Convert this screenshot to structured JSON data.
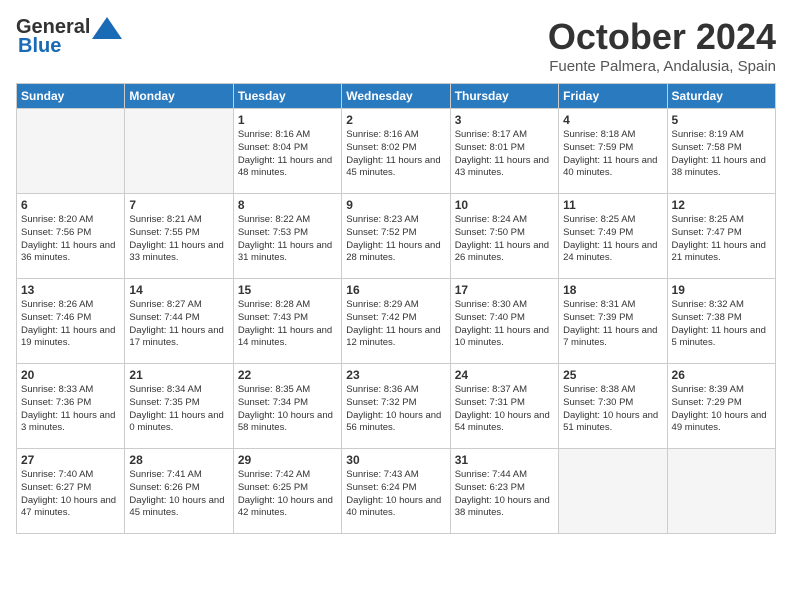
{
  "logo": {
    "line1": "General",
    "line2": "Blue"
  },
  "title": "October 2024",
  "subtitle": "Fuente Palmera, Andalusia, Spain",
  "days_of_week": [
    "Sunday",
    "Monday",
    "Tuesday",
    "Wednesday",
    "Thursday",
    "Friday",
    "Saturday"
  ],
  "weeks": [
    [
      {
        "day": "",
        "info": ""
      },
      {
        "day": "",
        "info": ""
      },
      {
        "day": "1",
        "info": "Sunrise: 8:16 AM\nSunset: 8:04 PM\nDaylight: 11 hours and 48 minutes."
      },
      {
        "day": "2",
        "info": "Sunrise: 8:16 AM\nSunset: 8:02 PM\nDaylight: 11 hours and 45 minutes."
      },
      {
        "day": "3",
        "info": "Sunrise: 8:17 AM\nSunset: 8:01 PM\nDaylight: 11 hours and 43 minutes."
      },
      {
        "day": "4",
        "info": "Sunrise: 8:18 AM\nSunset: 7:59 PM\nDaylight: 11 hours and 40 minutes."
      },
      {
        "day": "5",
        "info": "Sunrise: 8:19 AM\nSunset: 7:58 PM\nDaylight: 11 hours and 38 minutes."
      }
    ],
    [
      {
        "day": "6",
        "info": "Sunrise: 8:20 AM\nSunset: 7:56 PM\nDaylight: 11 hours and 36 minutes."
      },
      {
        "day": "7",
        "info": "Sunrise: 8:21 AM\nSunset: 7:55 PM\nDaylight: 11 hours and 33 minutes."
      },
      {
        "day": "8",
        "info": "Sunrise: 8:22 AM\nSunset: 7:53 PM\nDaylight: 11 hours and 31 minutes."
      },
      {
        "day": "9",
        "info": "Sunrise: 8:23 AM\nSunset: 7:52 PM\nDaylight: 11 hours and 28 minutes."
      },
      {
        "day": "10",
        "info": "Sunrise: 8:24 AM\nSunset: 7:50 PM\nDaylight: 11 hours and 26 minutes."
      },
      {
        "day": "11",
        "info": "Sunrise: 8:25 AM\nSunset: 7:49 PM\nDaylight: 11 hours and 24 minutes."
      },
      {
        "day": "12",
        "info": "Sunrise: 8:25 AM\nSunset: 7:47 PM\nDaylight: 11 hours and 21 minutes."
      }
    ],
    [
      {
        "day": "13",
        "info": "Sunrise: 8:26 AM\nSunset: 7:46 PM\nDaylight: 11 hours and 19 minutes."
      },
      {
        "day": "14",
        "info": "Sunrise: 8:27 AM\nSunset: 7:44 PM\nDaylight: 11 hours and 17 minutes."
      },
      {
        "day": "15",
        "info": "Sunrise: 8:28 AM\nSunset: 7:43 PM\nDaylight: 11 hours and 14 minutes."
      },
      {
        "day": "16",
        "info": "Sunrise: 8:29 AM\nSunset: 7:42 PM\nDaylight: 11 hours and 12 minutes."
      },
      {
        "day": "17",
        "info": "Sunrise: 8:30 AM\nSunset: 7:40 PM\nDaylight: 11 hours and 10 minutes."
      },
      {
        "day": "18",
        "info": "Sunrise: 8:31 AM\nSunset: 7:39 PM\nDaylight: 11 hours and 7 minutes."
      },
      {
        "day": "19",
        "info": "Sunrise: 8:32 AM\nSunset: 7:38 PM\nDaylight: 11 hours and 5 minutes."
      }
    ],
    [
      {
        "day": "20",
        "info": "Sunrise: 8:33 AM\nSunset: 7:36 PM\nDaylight: 11 hours and 3 minutes."
      },
      {
        "day": "21",
        "info": "Sunrise: 8:34 AM\nSunset: 7:35 PM\nDaylight: 11 hours and 0 minutes."
      },
      {
        "day": "22",
        "info": "Sunrise: 8:35 AM\nSunset: 7:34 PM\nDaylight: 10 hours and 58 minutes."
      },
      {
        "day": "23",
        "info": "Sunrise: 8:36 AM\nSunset: 7:32 PM\nDaylight: 10 hours and 56 minutes."
      },
      {
        "day": "24",
        "info": "Sunrise: 8:37 AM\nSunset: 7:31 PM\nDaylight: 10 hours and 54 minutes."
      },
      {
        "day": "25",
        "info": "Sunrise: 8:38 AM\nSunset: 7:30 PM\nDaylight: 10 hours and 51 minutes."
      },
      {
        "day": "26",
        "info": "Sunrise: 8:39 AM\nSunset: 7:29 PM\nDaylight: 10 hours and 49 minutes."
      }
    ],
    [
      {
        "day": "27",
        "info": "Sunrise: 7:40 AM\nSunset: 6:27 PM\nDaylight: 10 hours and 47 minutes."
      },
      {
        "day": "28",
        "info": "Sunrise: 7:41 AM\nSunset: 6:26 PM\nDaylight: 10 hours and 45 minutes."
      },
      {
        "day": "29",
        "info": "Sunrise: 7:42 AM\nSunset: 6:25 PM\nDaylight: 10 hours and 42 minutes."
      },
      {
        "day": "30",
        "info": "Sunrise: 7:43 AM\nSunset: 6:24 PM\nDaylight: 10 hours and 40 minutes."
      },
      {
        "day": "31",
        "info": "Sunrise: 7:44 AM\nSunset: 6:23 PM\nDaylight: 10 hours and 38 minutes."
      },
      {
        "day": "",
        "info": ""
      },
      {
        "day": "",
        "info": ""
      }
    ]
  ]
}
